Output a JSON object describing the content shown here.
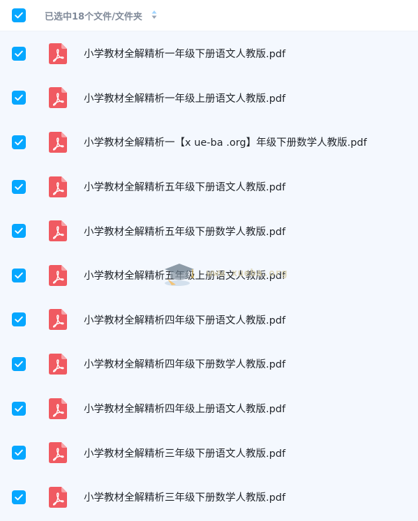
{
  "header": {
    "selection_text": "已选中18个文件/文件夹",
    "sort_icon": "sort-icon"
  },
  "colors": {
    "accent": "#06a7ff",
    "pdf_red": "#f05a61",
    "background": "#f4f8fe"
  },
  "files": [
    {
      "name": "小学教材全解精析一年级下册语文人教版.pdf",
      "checked": true,
      "icon": "pdf-file-icon"
    },
    {
      "name": "小学教材全解精析一年级上册语文人教版.pdf",
      "checked": true,
      "icon": "pdf-file-icon"
    },
    {
      "name": "小学教材全解精析一【x ue-ba .org】年级下册数学人教版.pdf",
      "checked": true,
      "icon": "pdf-file-icon"
    },
    {
      "name": "小学教材全解精析五年级下册语文人教版.pdf",
      "checked": true,
      "icon": "pdf-file-icon"
    },
    {
      "name": "小学教材全解精析五年级下册数学人教版.pdf",
      "checked": true,
      "icon": "pdf-file-icon"
    },
    {
      "name": "小学教材全解精析五年级上册语文人教版.pdf",
      "checked": true,
      "icon": "pdf-file-icon"
    },
    {
      "name": "小学教材全解精析四年级下册语文人教版.pdf",
      "checked": true,
      "icon": "pdf-file-icon"
    },
    {
      "name": "小学教材全解精析四年级下册数学人教版.pdf",
      "checked": true,
      "icon": "pdf-file-icon"
    },
    {
      "name": "小学教材全解精析四年级上册语文人教版.pdf",
      "checked": true,
      "icon": "pdf-file-icon"
    },
    {
      "name": "小学教材全解精析三年级下册语文人教版.pdf",
      "checked": true,
      "icon": "pdf-file-icon"
    },
    {
      "name": "小学教材全解精析三年级下册数学人教版.pdf",
      "checked": true,
      "icon": "pdf-file-icon"
    }
  ],
  "watermark": {
    "text": "www.xueba.org",
    "icon": "graduation-cap-icon"
  }
}
